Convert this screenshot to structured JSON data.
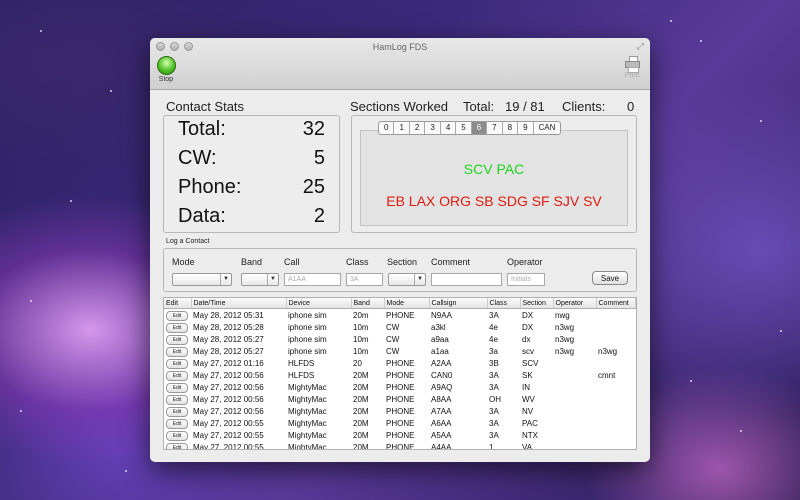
{
  "window": {
    "title": "HamLog FDS"
  },
  "toolbar": {
    "stop_label": "Stop",
    "print_label": "Print"
  },
  "contact_stats": {
    "title": "Contact Stats",
    "rows": [
      {
        "label": "Total:",
        "value": "32"
      },
      {
        "label": "CW:",
        "value": "5"
      },
      {
        "label": "Phone:",
        "value": "25"
      },
      {
        "label": "Data:",
        "value": "2"
      }
    ]
  },
  "sections_worked": {
    "title": "Sections Worked",
    "total_label": "Total:",
    "total_value": "19 / 81",
    "clients_label": "Clients:",
    "clients_value": "0",
    "tabs": [
      "0",
      "1",
      "2",
      "3",
      "4",
      "5",
      "6",
      "7",
      "8",
      "9",
      "CAN"
    ],
    "active_tab": "6",
    "worked": "SCV PAC",
    "not_worked": "EB LAX ORG SB SDG SF SJV SV",
    "worked_color": "#1bd61b",
    "not_worked_color": "#e21a0e"
  },
  "log_contact": {
    "title": "Log a Contact",
    "labels": {
      "mode": "Mode",
      "band": "Band",
      "call": "Call",
      "class": "Class",
      "section": "Section",
      "comment": "Comment",
      "operator": "Operator"
    },
    "placeholders": {
      "call": "A1AA",
      "class": "3A",
      "operator": "Initials"
    },
    "save_label": "Save"
  },
  "log_table": {
    "columns": [
      "Edit",
      "Date/Time",
      "Device",
      "Band",
      "Mode",
      "Callsign",
      "Class",
      "Section",
      "Operator",
      "Comment"
    ],
    "edit_label": "Edit",
    "rows": [
      [
        "May 28, 2012 05:31",
        "iphone sim",
        "20m",
        "PHONE",
        "N9AA",
        "3A",
        "DX",
        "nwg",
        ""
      ],
      [
        "May 28, 2012 05:28",
        "iphone sim",
        "10m",
        "CW",
        "a3kl",
        "4e",
        "DX",
        "n3wg",
        ""
      ],
      [
        "May 28, 2012 05:27",
        "iphone sim",
        "10m",
        "CW",
        "a9aa",
        "4e",
        "dx",
        "n3wg",
        ""
      ],
      [
        "May 28, 2012 05:27",
        "iphone sim",
        "10m",
        "CW",
        "a1aa",
        "3a",
        "scv",
        "n3wg",
        "n3wg"
      ],
      [
        "May 27, 2012 01:16",
        "HLFDS",
        "20",
        "PHONE",
        "A2AA",
        "3B",
        "SCV",
        "",
        ""
      ],
      [
        "May 27, 2012 00:56",
        "HLFDS",
        "20M",
        "PHONE",
        "CAN0",
        "3A",
        "SK",
        "",
        "cmnt"
      ],
      [
        "May 27, 2012 00:56",
        "MightyMac",
        "20M",
        "PHONE",
        "A9AQ",
        "3A",
        "IN",
        "",
        ""
      ],
      [
        "May 27, 2012 00:56",
        "MightyMac",
        "20M",
        "PHONE",
        "A8AA",
        "OH",
        "WV",
        "",
        ""
      ],
      [
        "May 27, 2012 00:56",
        "MightyMac",
        "20M",
        "PHONE",
        "A7AA",
        "3A",
        "NV",
        "",
        ""
      ],
      [
        "May 27, 2012 00:55",
        "MightyMac",
        "20M",
        "PHONE",
        "A6AA",
        "3A",
        "PAC",
        "",
        ""
      ],
      [
        "May 27, 2012 00:55",
        "MightyMac",
        "20M",
        "PHONE",
        "A5AA",
        "3A",
        "NTX",
        "",
        ""
      ],
      [
        "May 27, 2012 00:55",
        "MightyMac",
        "20M",
        "PHONE",
        "A4AA",
        "1",
        "VA",
        "",
        ""
      ]
    ]
  }
}
